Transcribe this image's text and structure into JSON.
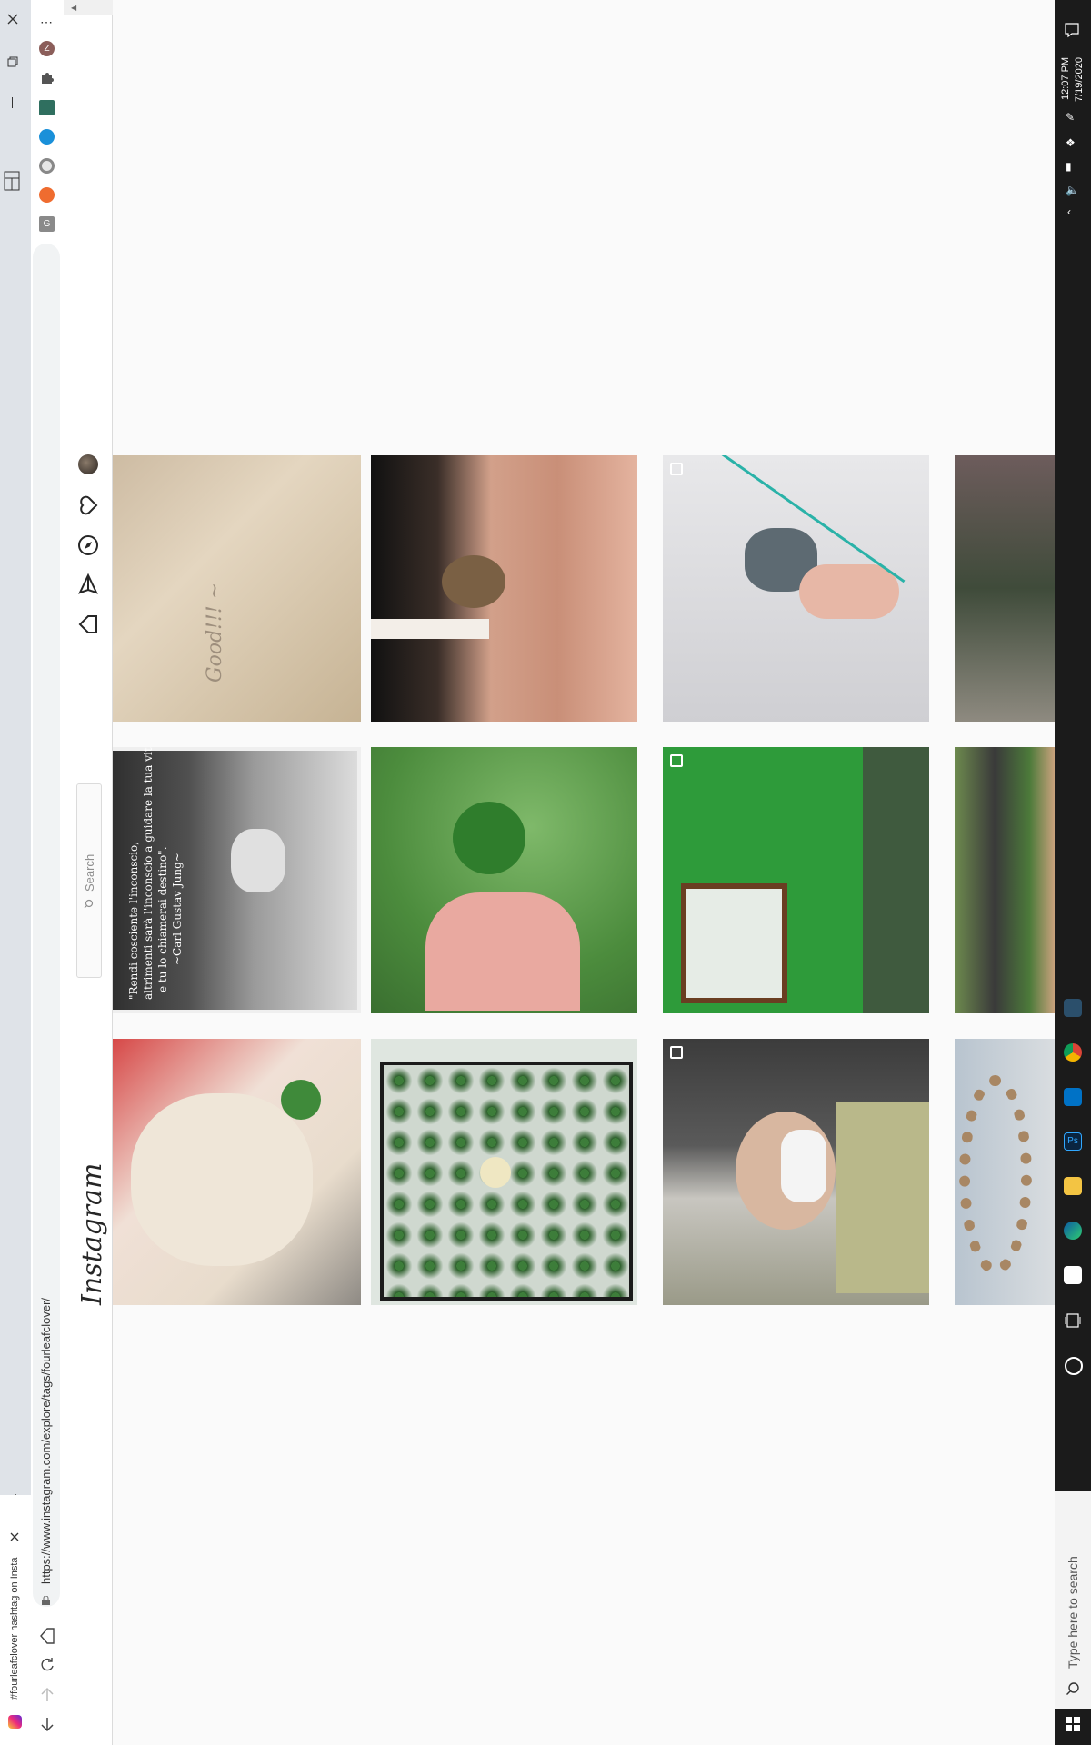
{
  "browser": {
    "tab_title": "#fourleafclover hashtag on Insta",
    "url": "https://www.instagram.com/explore/tags/fourleafclover/",
    "profile_initial": "Z"
  },
  "instagram": {
    "logo_text": "Instagram",
    "search_placeholder": "Search"
  },
  "posts": {
    "quote_lines": [
      "\"Rendi cosciente l'inconscio,",
      "altrimenti sarà l'inconscio a guidare la tua vita",
      "e tu lo chiamerai destino\".",
      "~Carl Gustav Jung~"
    ],
    "handwritten_note": "Good!!! ~"
  },
  "taskbar": {
    "time": "12:07 PM",
    "date": "7/19/2020",
    "search_placeholder": "Type here to search"
  },
  "colors": {
    "instagram_text": "#262626",
    "taskbar_bg": "#1b1b1b",
    "chrome_bg": "#dfe3e8",
    "clover_green": "#3f8a3a",
    "wall_green": "#2e9b3a"
  }
}
